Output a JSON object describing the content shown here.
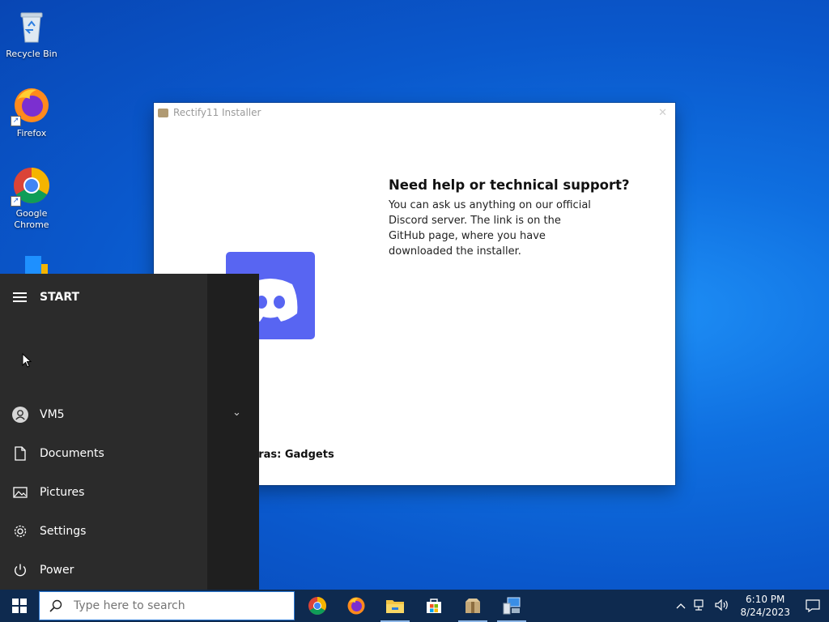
{
  "desktop": {
    "icons": [
      {
        "label": "Recycle Bin"
      },
      {
        "label": "Firefox"
      },
      {
        "label": "Google\nChrome"
      }
    ]
  },
  "installer": {
    "title": "Rectify11 Installer",
    "heading": "Need help or technical support?",
    "body": "You can ask us anything on our official Discord server. The link is on the GitHub page, where you have downloaded the installer.",
    "extras": "tras: Gadgets"
  },
  "start_menu": {
    "header": "START",
    "user": "VM5",
    "items": [
      {
        "label": "Documents",
        "icon": "document-icon"
      },
      {
        "label": "Pictures",
        "icon": "pictures-icon"
      },
      {
        "label": "Settings",
        "icon": "gear-icon"
      },
      {
        "label": "Power",
        "icon": "power-icon"
      }
    ]
  },
  "taskbar": {
    "search_placeholder": "Type here to search",
    "apps": [
      "Google Chrome",
      "Firefox",
      "File Explorer",
      "Microsoft Store",
      "Rectify11 Installer",
      "Network utility"
    ],
    "time": "6:10 PM",
    "date": "8/24/2023"
  },
  "colors": {
    "accent": "#0a58cc",
    "discord": "#5865f2",
    "start_bg": "#2b2b2b",
    "taskbar_bg": "#0e2a4f"
  }
}
